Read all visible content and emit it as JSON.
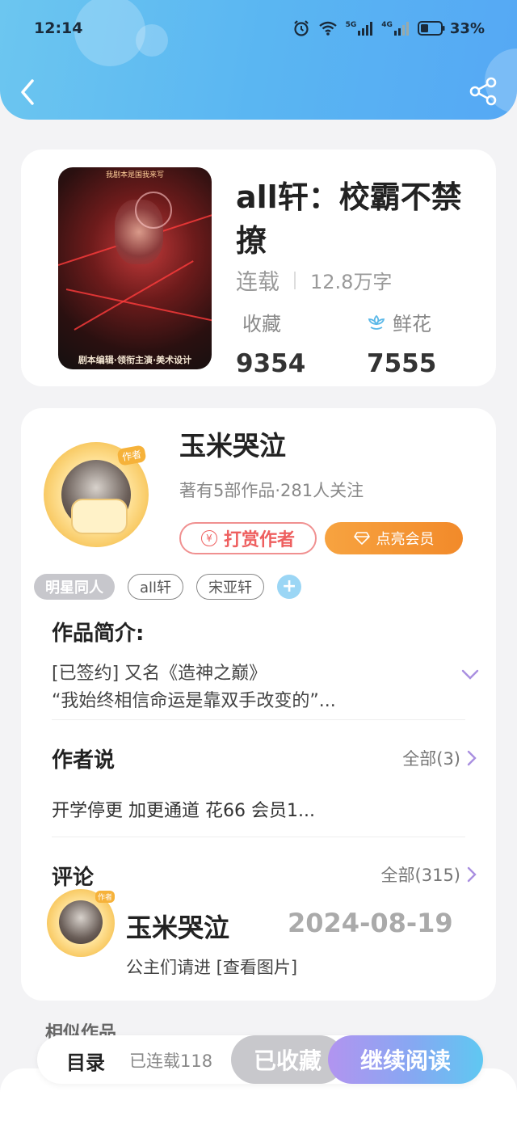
{
  "status_bar": {
    "time": "12:14",
    "battery": "33%",
    "icons": [
      "alarm-icon",
      "wifi-icon",
      "signal-5g-icon",
      "signal-4g-icon",
      "battery-icon"
    ],
    "net1": "5G",
    "net2": "4G"
  },
  "header": {
    "back_icon": "chevron-left-icon",
    "share_icon": "share-icon",
    "color": "#5ab6f2"
  },
  "book": {
    "title": "all轩：校霸不禁撩",
    "status": "连载",
    "word_count": "12.8万字",
    "favorites_label": "收藏",
    "favorites": "9354",
    "flowers_label": "鲜花",
    "flowers": "7555",
    "cover_top_text": "我剧本是国我来写",
    "cover_bottom_text": "剧本编辑·领衔主演·美术设计"
  },
  "author": {
    "name": "玉米哭泣",
    "badge": "作者",
    "summary": "著有5部作品·281人关注",
    "reward_button": "打赏作者",
    "vip_button": "点亮会员"
  },
  "tags": {
    "primary": "明星同人",
    "items": [
      "all轩",
      "宋亚轩"
    ]
  },
  "intro": {
    "title": "作品简介:",
    "line1": "[已签约] 又名《造神之巅》",
    "line2": "“我始终相信命运是靠双手改变的”..."
  },
  "author_says": {
    "title": "作者说",
    "more": "全部(3)",
    "text": "开学停更 加更通道 花66 会员1..."
  },
  "comments": {
    "title": "评论",
    "more": "全部(315)",
    "first": {
      "name": "玉米哭泣",
      "badge": "作者",
      "date": "2024-08-19",
      "text": "公主们请进  [查看图片]"
    }
  },
  "similar": {
    "title": "相似作品"
  },
  "bottom_bar": {
    "toc": "目录",
    "progress": "已连载118",
    "collected": "已收藏",
    "read": "继续阅读"
  }
}
